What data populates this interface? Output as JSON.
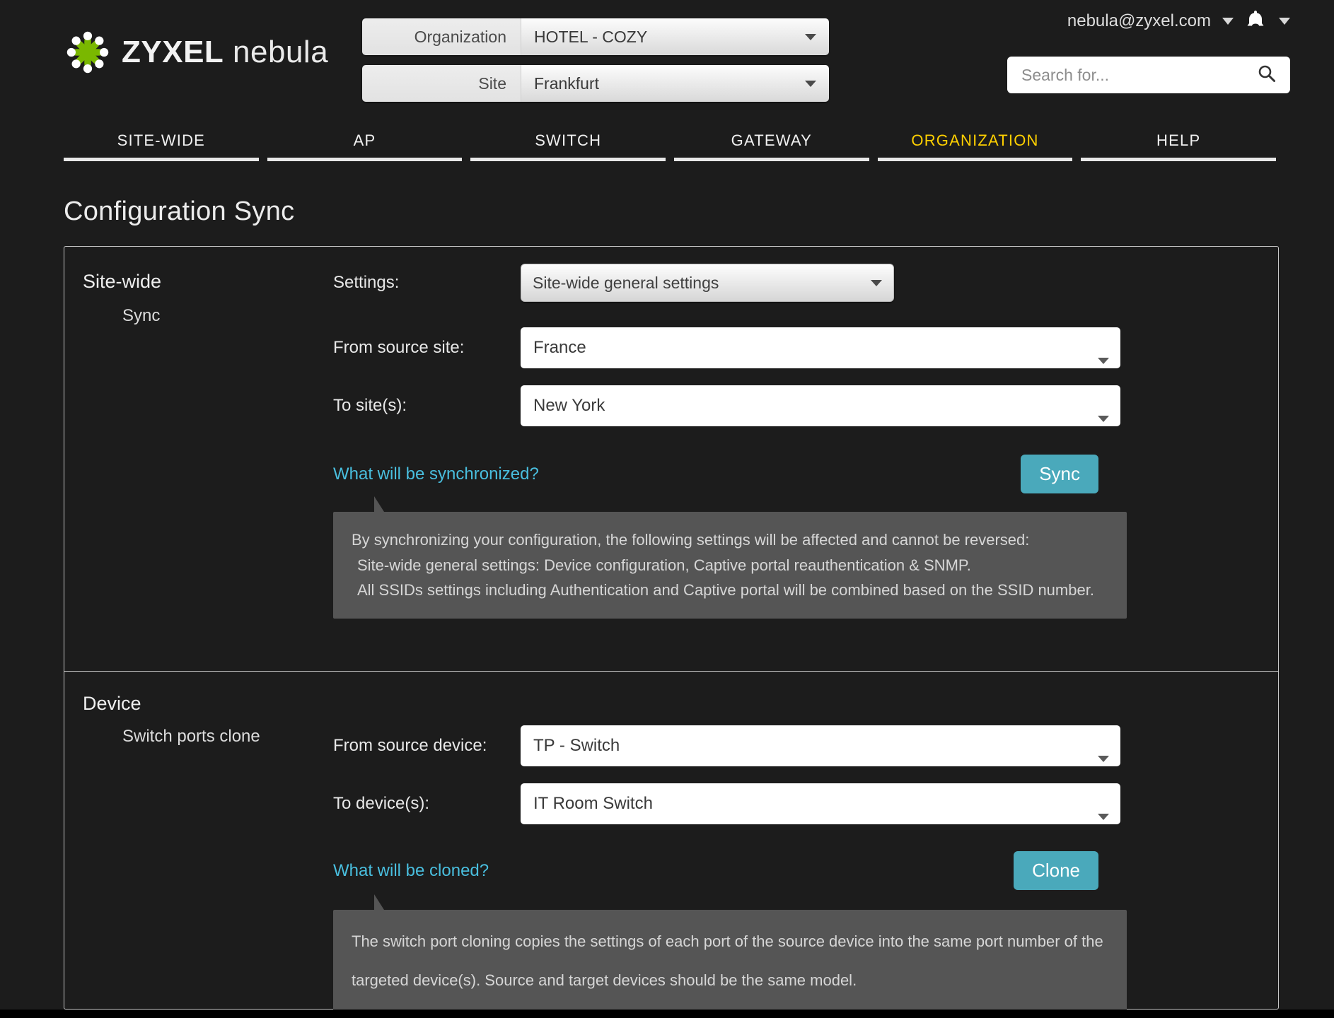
{
  "brand": {
    "name_bold": "ZYXEL",
    "name_thin": "nebula",
    "logo_icon": "zyxel-flower-logo"
  },
  "header": {
    "org_label": "Organization",
    "org_value": "HOTEL - COZY",
    "site_label": "Site",
    "site_value": "Frankfurt",
    "account_email": "nebula@zyxel.com",
    "bell_icon": "notification-bell-icon",
    "search_placeholder": "Search for...",
    "search_value": "",
    "search_icon": "search-icon"
  },
  "nav": {
    "items": [
      {
        "label": "SITE-WIDE",
        "active": false
      },
      {
        "label": "AP",
        "active": false
      },
      {
        "label": "SWITCH",
        "active": false
      },
      {
        "label": "GATEWAY",
        "active": false
      },
      {
        "label": "ORGANIZATION",
        "active": true
      },
      {
        "label": "HELP",
        "active": false
      }
    ]
  },
  "page": {
    "title": "Configuration Sync"
  },
  "sitewide": {
    "heading": "Site-wide",
    "sub_heading": "Sync",
    "settings_label": "Settings:",
    "settings_value": "Site-wide general settings",
    "from_label": "From source site:",
    "from_value": "France",
    "to_label": "To site(s):",
    "to_value": "New York",
    "question_link": "What will be synchronized?",
    "sync_button": "Sync",
    "tooltip_lines": [
      "By synchronizing your configuration, the following settings will be affected and cannot be reversed:",
      "Site-wide general settings: Device configuration, Captive portal reauthentication & SNMP.",
      "All SSIDs settings including Authentication and Captive portal will be combined based on the SSID number."
    ]
  },
  "device": {
    "heading": "Device",
    "sub_heading": "Switch ports clone",
    "from_label": "From source device:",
    "from_value": "TP - Switch",
    "to_label": "To device(s):",
    "to_value": "IT Room Switch",
    "question_link": "What will be cloned?",
    "clone_button": "Clone",
    "tooltip_lines": [
      "The switch port cloning copies the settings of each port of the source device into the same port number of the",
      "targeted device(s). Source and target devices should be the same model."
    ]
  },
  "colors": {
    "background": "#1c1c1c",
    "accent_active_tab": "#ffd000",
    "link": "#49bede",
    "button": "#4aa9bb",
    "tooltip_bg": "#555555",
    "logo_green": "#7ab800"
  }
}
